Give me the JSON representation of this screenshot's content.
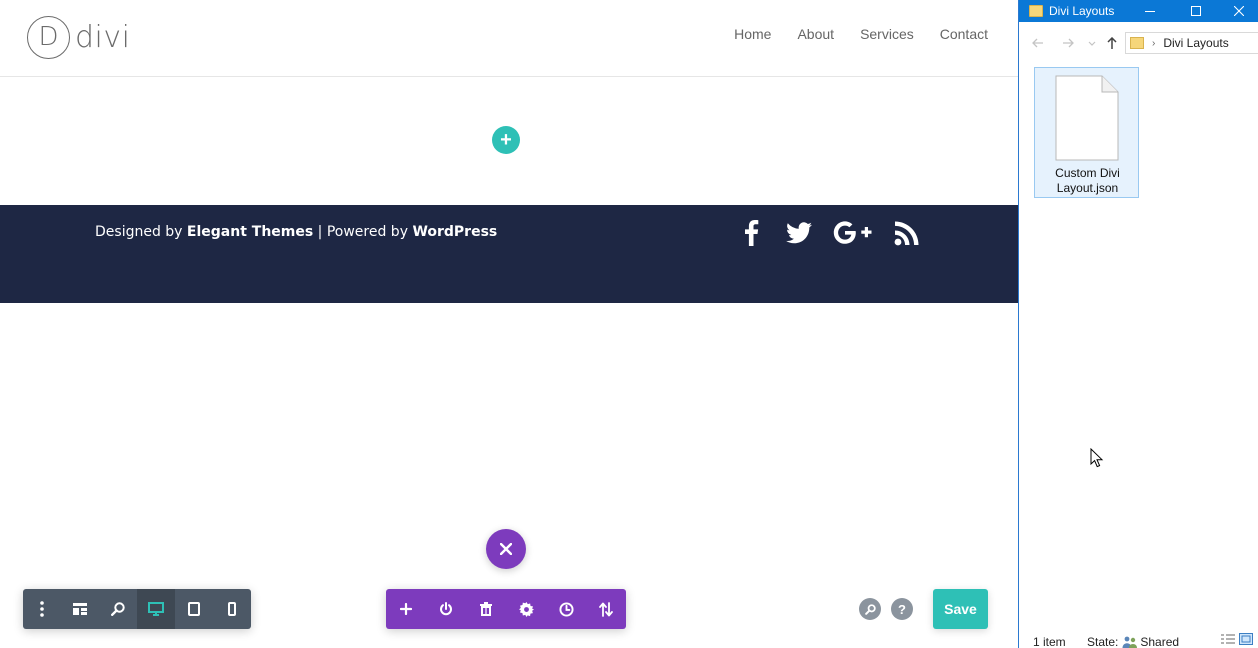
{
  "site": {
    "logo_mark": "D",
    "logo_text": "divi",
    "nav": [
      "Home",
      "About",
      "Services",
      "Contact"
    ],
    "add_section_symbol": "+",
    "footer": {
      "credit_prefix": "Designed by ",
      "credit_brand": "Elegant Themes",
      "credit_mid": " | Powered by ",
      "credit_cms": "WordPress",
      "social_icons": [
        "facebook-icon",
        "twitter-icon",
        "google-plus-icon",
        "rss-icon"
      ]
    }
  },
  "builder": {
    "left_bar_icons": [
      "more-options-icon",
      "wireframe-view-icon",
      "zoom-icon",
      "desktop-view-icon",
      "tablet-view-icon",
      "phone-view-icon"
    ],
    "left_bar_active": "desktop-view-icon",
    "main_bar_icons": [
      "add-icon",
      "power-icon",
      "trash-icon",
      "settings-icon",
      "history-icon",
      "sort-icon"
    ],
    "close_icon": "close-icon",
    "help_symbol": "?",
    "save_label": "Save",
    "colors": {
      "accent_teal": "#2ec0b6",
      "accent_purple": "#7d3bbd",
      "footer_bg": "#1e2744",
      "left_bar_bg": "#4c5866"
    }
  },
  "explorer": {
    "title": "Divi Layouts",
    "address": "Divi Layouts",
    "file_name": "Custom Divi Layout.json",
    "status_count": "1 item",
    "status_state_label": "State:",
    "status_state_value": "Shared",
    "colors": {
      "titlebar": "#0b78d6",
      "selection": "#e6f2fd"
    }
  }
}
